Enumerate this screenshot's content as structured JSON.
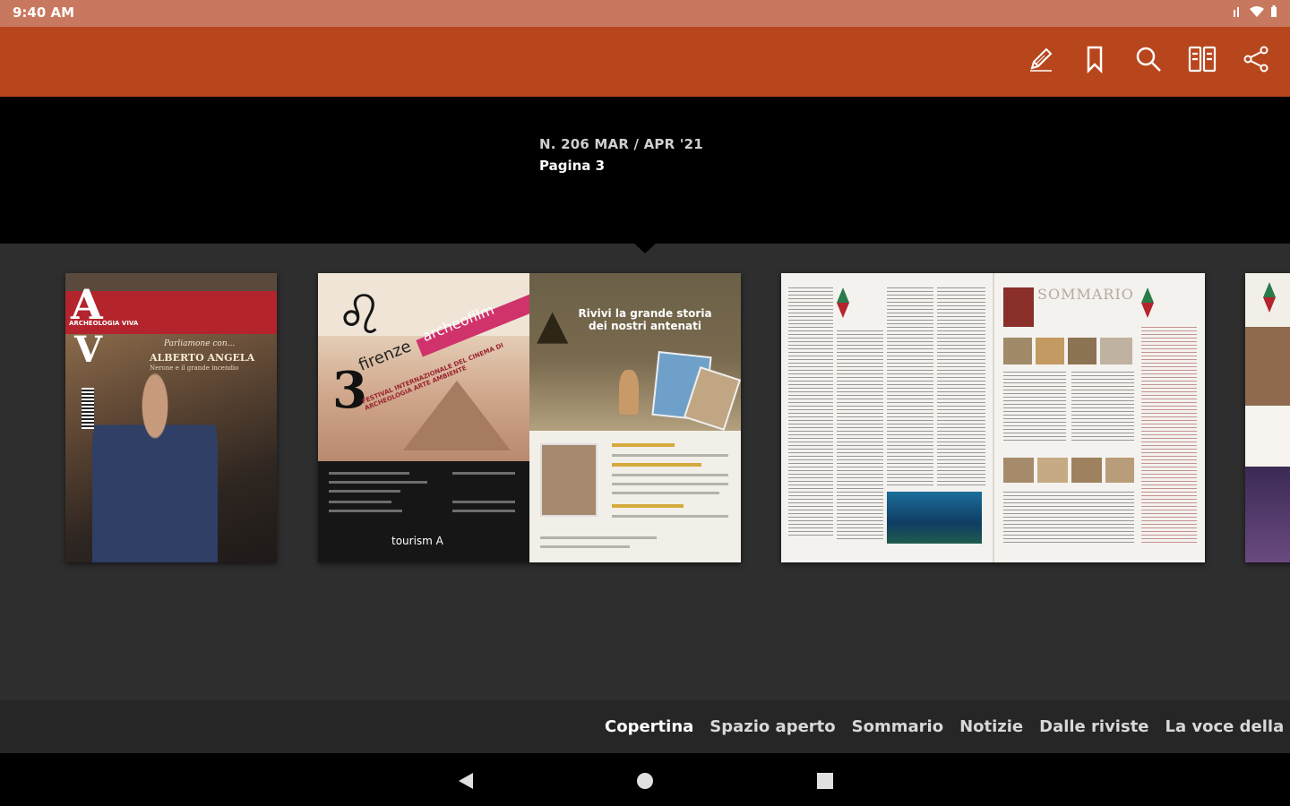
{
  "status_bar": {
    "time": "9:40 AM"
  },
  "app_bar": {
    "actions": [
      {
        "icon": "pencil-icon"
      },
      {
        "icon": "bookmark-icon"
      },
      {
        "icon": "search-icon"
      },
      {
        "icon": "two-page-view-icon"
      },
      {
        "icon": "share-icon"
      }
    ]
  },
  "issue_info": {
    "issue": "N. 206 MAR / APR '21",
    "page": "Pagina 3"
  },
  "pages": {
    "cover": {
      "logo_top": "A",
      "logo_bottom": "V",
      "magazine": "ARCHEOLOGIA VIVA",
      "tagline": "Parliamone con...",
      "name": "ALBERTO ANGELA",
      "subtitle": "Nerone e il grande incendio"
    },
    "spread1": {
      "left_number": "3",
      "left_city": "firenze",
      "left_event": "archeofilm",
      "left_festival": "FESTIVAL INTERNAZIONALE DEL CINEMA DI ARCHEOLOGIA ARTE AMBIENTE",
      "left_sponsor": "tourism A",
      "right_headline": "Rivivi la grande storia dei nostri antenati"
    },
    "spread2": {
      "title": "SOMMARIO"
    }
  },
  "chapters": [
    {
      "label": "Copertina",
      "active": true
    },
    {
      "label": "Spazio aperto",
      "active": false
    },
    {
      "label": "Sommario",
      "active": false
    },
    {
      "label": "Notizie",
      "active": false
    },
    {
      "label": "Dalle riviste",
      "active": false
    },
    {
      "label": "La voce della storia.",
      "active": false
    }
  ],
  "colors": {
    "status_bar": "#c8785e",
    "app_bar": "#b8461d",
    "background": "#000000",
    "thumbnail_strip": "#2e2e2e",
    "chapter_bar": "#262626"
  }
}
